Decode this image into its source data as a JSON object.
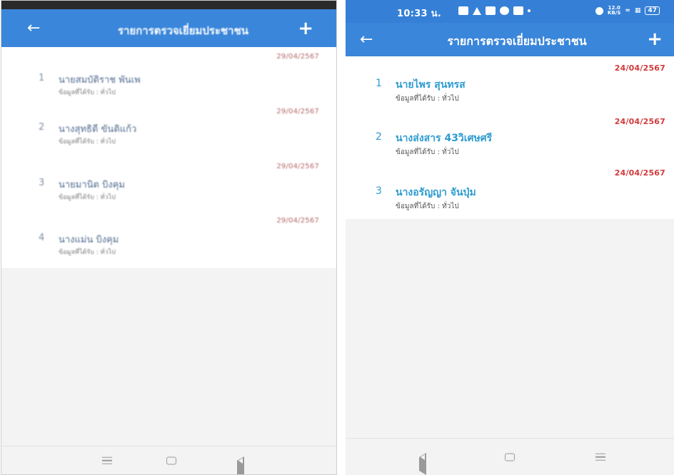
{
  "left_screen": {
    "appbar": {
      "title": "รายการตรวจเยี่ยมประชาชน",
      "back_icon": "arrow-left-icon",
      "add_icon": "plus-icon"
    },
    "records": [
      {
        "number": "1",
        "name": "นายสมบัติราช พันเพ",
        "info": "ข้อมูลที่ได้รับ : ทั่วไป",
        "date": "29/04/2567"
      },
      {
        "number": "2",
        "name": "นางสุทธิดี ขันติแก้ว",
        "info": "ข้อมูลที่ได้รับ : ทั่วไป",
        "date": "29/04/2567"
      },
      {
        "number": "3",
        "name": "นายมานิต บิงคุม",
        "info": "ข้อมูลที่ได้รับ : ทั่วไป",
        "date": "29/04/2567"
      },
      {
        "number": "4",
        "name": "นางแม่น บิงคุม",
        "info": "ข้อมูลที่ได้รับ : ทั่วไป",
        "date": "29/04/2567"
      }
    ]
  },
  "right_screen": {
    "status_bar": {
      "time": "10:33 น.",
      "speed_top": "12.0",
      "speed_bottom": "KB/S",
      "battery": "47"
    },
    "appbar": {
      "title": "รายการตรวจเยี่ยมประชาชน",
      "back_icon": "arrow-left-icon",
      "add_icon": "plus-icon"
    },
    "records": [
      {
        "number": "1",
        "name": "นายไพร สุนทรส",
        "info": "ข้อมูลที่ได้รับ : ทั่วไป",
        "date": "24/04/2567"
      },
      {
        "number": "2",
        "name": "นางส่งสาร 43วิเศษศรี",
        "info": "ข้อมูลที่ได้รับ : ทั่วไป",
        "date": "24/04/2567"
      },
      {
        "number": "3",
        "name": "นางอรัญญา จันปุ่ม",
        "info": "ข้อมูลที่ได้รับ : ทั่วไป",
        "date": "24/04/2567"
      }
    ]
  },
  "colors": {
    "appbar": "#3a86da",
    "name_text": "#2e9bd0",
    "date_text": "#d23a3a"
  }
}
